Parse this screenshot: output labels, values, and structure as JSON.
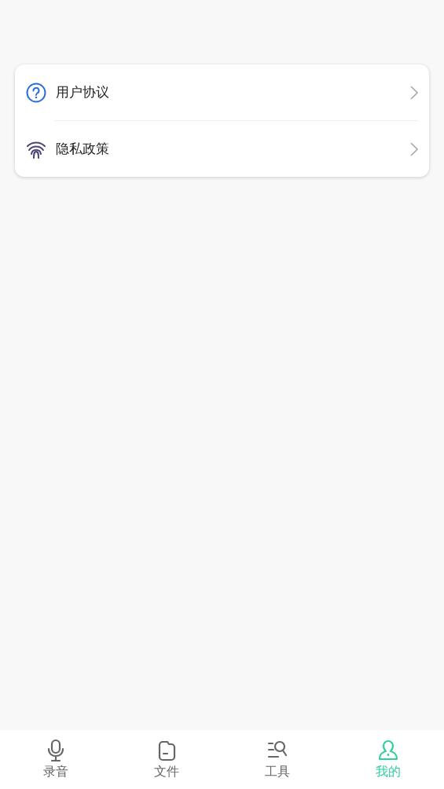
{
  "menu": [
    {
      "label": "用户协议"
    },
    {
      "label": "隐私政策"
    }
  ],
  "tabs": [
    {
      "label": "录音",
      "selected": false
    },
    {
      "label": "文件",
      "selected": false
    },
    {
      "label": "工具",
      "selected": false
    },
    {
      "label": "我的",
      "selected": true
    }
  ]
}
